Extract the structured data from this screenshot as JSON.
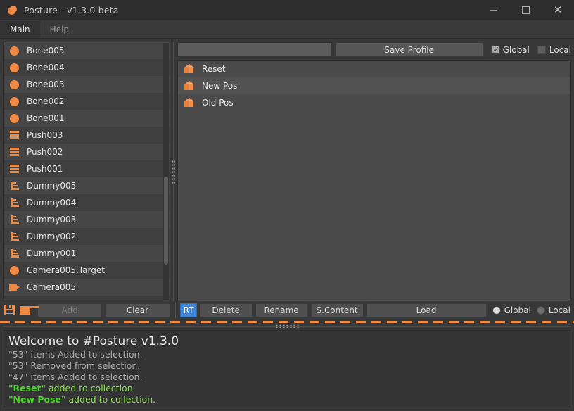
{
  "window": {
    "title": "Posture - v1.3.0 beta",
    "icon": "sphere-icon",
    "minimize_label": "–",
    "maximize_label": "□",
    "close_label": "✕"
  },
  "tabs": [
    {
      "label": "Main",
      "active": true
    },
    {
      "label": "Help",
      "active": false
    }
  ],
  "object_list": {
    "items": [
      {
        "label": "Camera005",
        "icon": "camera-icon"
      },
      {
        "label": "Camera005.Target",
        "icon": "sphere-icon"
      },
      {
        "label": "Dummy001",
        "icon": "dummy-icon"
      },
      {
        "label": "Dummy002",
        "icon": "dummy-icon"
      },
      {
        "label": "Dummy003",
        "icon": "dummy-icon"
      },
      {
        "label": "Dummy004",
        "icon": "dummy-icon"
      },
      {
        "label": "Dummy005",
        "icon": "dummy-icon"
      },
      {
        "label": "Push001",
        "icon": "push-icon"
      },
      {
        "label": "Push002",
        "icon": "push-icon"
      },
      {
        "label": "Push003",
        "icon": "push-icon"
      },
      {
        "label": "Bone001",
        "icon": "sphere-icon"
      },
      {
        "label": "Bone002",
        "icon": "sphere-icon"
      },
      {
        "label": "Bone003",
        "icon": "sphere-icon"
      },
      {
        "label": "Bone004",
        "icon": "sphere-icon"
      },
      {
        "label": "Bone005",
        "icon": "sphere-icon"
      }
    ]
  },
  "profile_bar": {
    "input_value": "",
    "input_placeholder": "",
    "save_profile_label": "Save Profile",
    "global_label": "Global",
    "local_label": "Local",
    "global_checked": true,
    "local_checked": false
  },
  "pose_list": {
    "items": [
      {
        "label": "Reset",
        "icon": "box-icon"
      },
      {
        "label": "New Pos",
        "icon": "box-icon"
      },
      {
        "label": "Old Pos",
        "icon": "box-icon"
      }
    ]
  },
  "toolbar": {
    "save_icon": "save-icon",
    "folder_icon": "folder-icon",
    "add_label": "Add",
    "clear_label": "Clear",
    "rt_label": "RT",
    "delete_label": "Delete",
    "rename_label": "Rename",
    "scontent_label": "S.Content",
    "load_label": "Load",
    "global_label": "Global",
    "local_label": "Local",
    "global_selected": true,
    "local_selected": false
  },
  "log": {
    "lines": [
      {
        "text": "Welcome to #Posture v1.3.0",
        "style": "welcome"
      },
      {
        "text": "\"53\" items Added to selection.",
        "style": "normal"
      },
      {
        "text": "\"53\" Removed from selection.",
        "style": "normal"
      },
      {
        "text": "\"47\" items Added to selection.",
        "style": "normal"
      },
      {
        "highlight": "\"Reset\"",
        "text": " added to collection.",
        "style": "green"
      },
      {
        "highlight": "\"New Pose\"",
        "text": " added to collection.",
        "style": "green"
      }
    ]
  },
  "colors": {
    "accent_orange": "#ef8a44",
    "window_bg": "#383838",
    "titlebar_bg": "#2d2d2d",
    "active_blue": "#3f87d6",
    "log_green": "#4dd62a"
  }
}
